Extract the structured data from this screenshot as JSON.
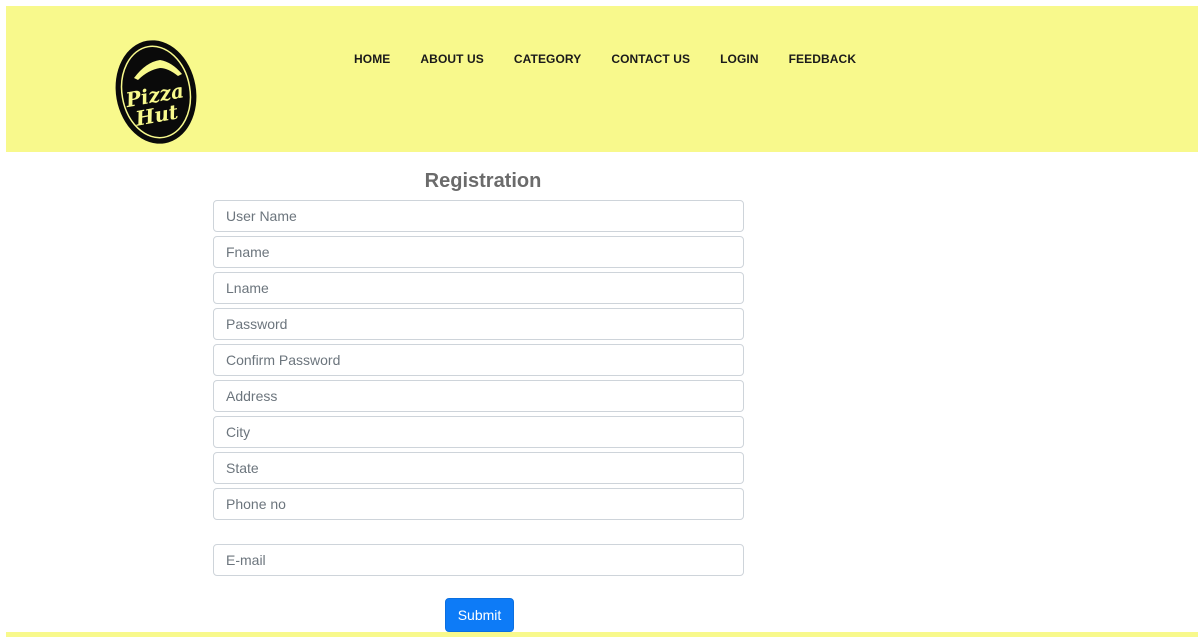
{
  "brand": {
    "logo_line1": "Pizza",
    "logo_line2": "Hut",
    "colors": {
      "header_bg": "#f8f98c",
      "accent": "#0d7bf7"
    }
  },
  "nav": {
    "items": [
      {
        "label": "HOME"
      },
      {
        "label": "ABOUT US"
      },
      {
        "label": "CATEGORY"
      },
      {
        "label": "CONTACT US"
      },
      {
        "label": "LOGIN"
      },
      {
        "label": "FEEDBACK"
      }
    ]
  },
  "form": {
    "title": "Registration",
    "fields": {
      "username": {
        "placeholder": "User Name",
        "value": ""
      },
      "fname": {
        "placeholder": "Fname",
        "value": ""
      },
      "lname": {
        "placeholder": "Lname",
        "value": ""
      },
      "password": {
        "placeholder": "Password",
        "value": ""
      },
      "confirm_password": {
        "placeholder": "Confirm Password",
        "value": ""
      },
      "address": {
        "placeholder": "Address",
        "value": ""
      },
      "city": {
        "placeholder": "City",
        "value": ""
      },
      "state": {
        "placeholder": "State",
        "value": ""
      },
      "phone": {
        "placeholder": "Phone no",
        "value": ""
      },
      "email": {
        "placeholder": "E-mail",
        "value": ""
      }
    },
    "submit_label": "Submit"
  }
}
